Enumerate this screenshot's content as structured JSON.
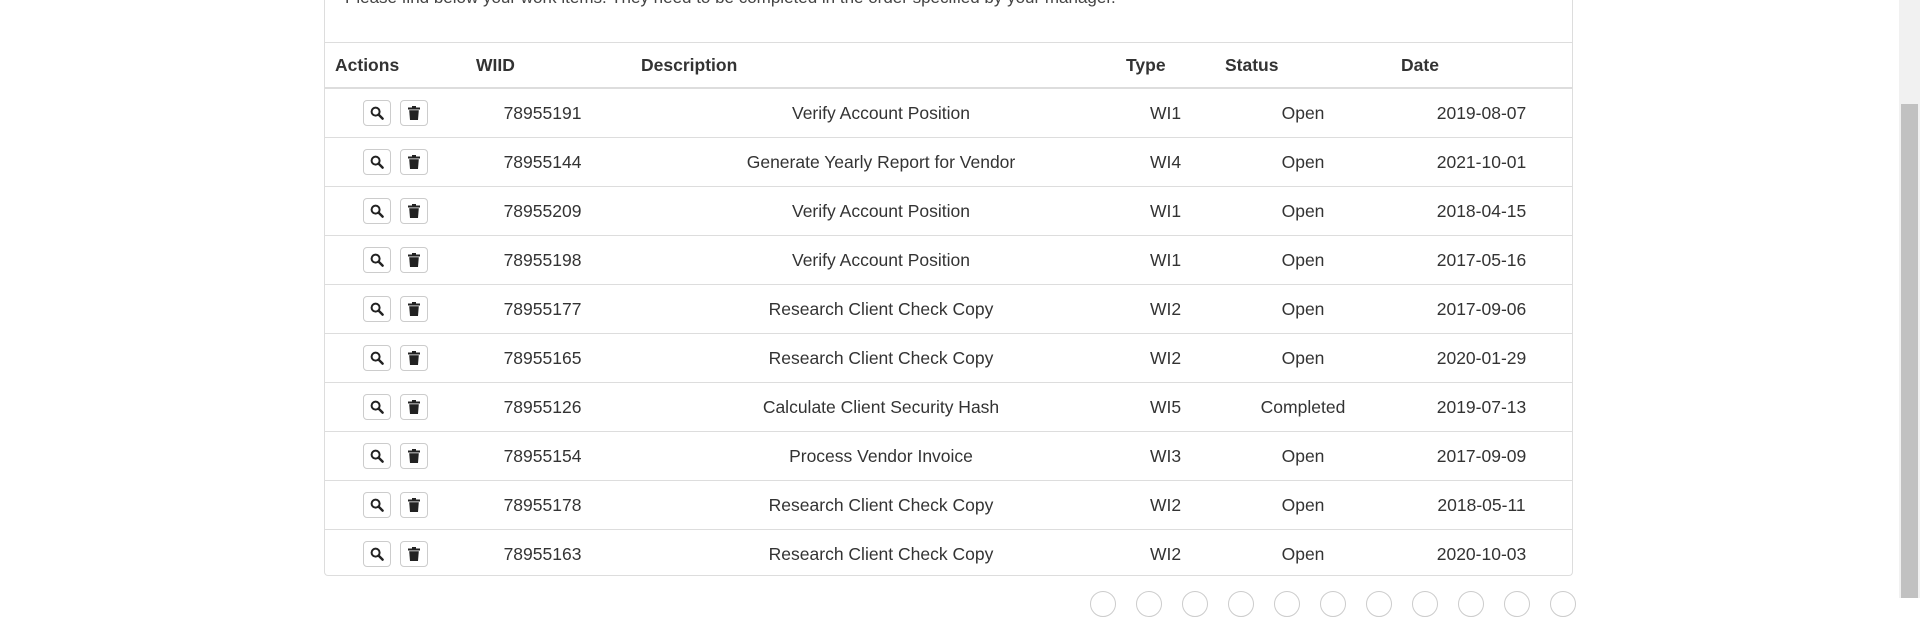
{
  "intro_text": "Please find below your work items. They need to be completed in the order specified by your manager.",
  "table": {
    "headers": {
      "actions": "Actions",
      "wiid": "WIID",
      "description": "Description",
      "type": "Type",
      "status": "Status",
      "date": "Date"
    },
    "rows": [
      {
        "wiid": "78955191",
        "description": "Verify Account Position",
        "type": "WI1",
        "status": "Open",
        "date": "2019-08-07"
      },
      {
        "wiid": "78955144",
        "description": "Generate Yearly Report for Vendor",
        "type": "WI4",
        "status": "Open",
        "date": "2021-10-01"
      },
      {
        "wiid": "78955209",
        "description": "Verify Account Position",
        "type": "WI1",
        "status": "Open",
        "date": "2018-04-15"
      },
      {
        "wiid": "78955198",
        "description": "Verify Account Position",
        "type": "WI1",
        "status": "Open",
        "date": "2017-05-16"
      },
      {
        "wiid": "78955177",
        "description": "Research Client Check Copy",
        "type": "WI2",
        "status": "Open",
        "date": "2017-09-06"
      },
      {
        "wiid": "78955165",
        "description": "Research Client Check Copy",
        "type": "WI2",
        "status": "Open",
        "date": "2020-01-29"
      },
      {
        "wiid": "78955126",
        "description": "Calculate Client Security Hash",
        "type": "WI5",
        "status": "Completed",
        "date": "2019-07-13"
      },
      {
        "wiid": "78955154",
        "description": "Process Vendor Invoice",
        "type": "WI3",
        "status": "Open",
        "date": "2017-09-09"
      },
      {
        "wiid": "78955178",
        "description": "Research Client Check Copy",
        "type": "WI2",
        "status": "Open",
        "date": "2018-05-11"
      },
      {
        "wiid": "78955163",
        "description": "Research Client Check Copy",
        "type": "WI2",
        "status": "Open",
        "date": "2020-10-03"
      }
    ]
  },
  "icons": {
    "view": "search-icon",
    "delete": "trash-icon"
  },
  "colors": {
    "border": "#dddddd",
    "text": "#333333",
    "scrollbar_thumb": "#c1c1c1"
  }
}
